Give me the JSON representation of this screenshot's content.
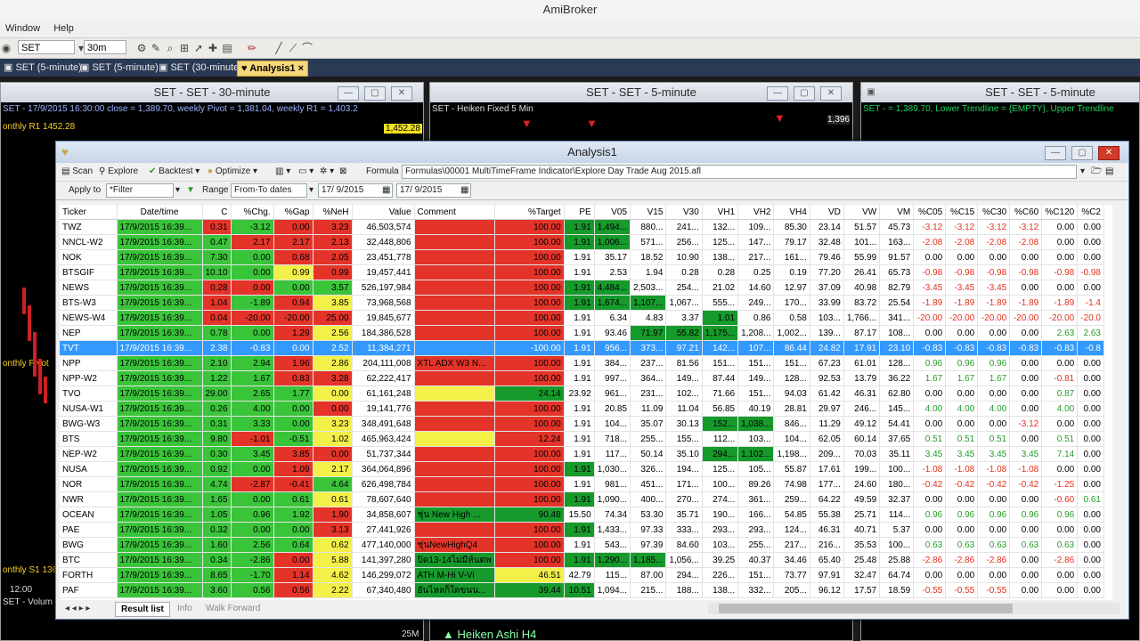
{
  "app": {
    "title": "AmiBroker",
    "menu": [
      "Window",
      "Help"
    ]
  },
  "toolbar": {
    "symbol": "SET",
    "interval": "30m"
  },
  "doc_tabs": [
    "SET (5-minute)",
    "SET (5-minute)",
    "SET (30-minute)",
    "Analysis1"
  ],
  "chart1": {
    "title": "SET - SET - 30-minute",
    "info": "SET - 17/9/2015 16:30:00 close = 1,389.70, weekly Pivot = 1,381.04, weekly R1 = 1,403.2",
    "label1": "onthly R1 1452.28",
    "label2": "onthly Pivot",
    "label3": "onthly S1 136",
    "price_tag": "1,452.28",
    "time_tag": "12:00",
    "bottom": "SET - Volum"
  },
  "chart2": {
    "title": "SET - SET - 5-minute",
    "info": "SET - Heiken Fixed 5 Min",
    "bottom": "Heiken Ashi H4",
    "vol": "25M"
  },
  "chart3": {
    "title": "SET - SET - 5-minute",
    "info": "SET - = 1,389.70, Lower Trendline = {EMPTY}, Upper Trendline",
    "price_tag": "1,396"
  },
  "analysis": {
    "title": "Analysis1",
    "scan": "Scan",
    "explore": "Explore",
    "backtest": "Backtest",
    "optimize": "Optimize",
    "formula_label": "Formula",
    "formula": "Formulas\\00001 MultiTimeFrame Indicator\\Explore Day Trade Aug 2015.afl",
    "apply_label": "Apply to",
    "apply_value": "*Filter",
    "range_label": "Range",
    "range_value": "From-To dates",
    "from_date": "17/ 9/2015",
    "to_date": "17/ 9/2015",
    "bottom_tabs": [
      "Result list",
      "Info",
      "Walk Forward"
    ]
  },
  "columns": [
    "Ticker",
    "Date/time",
    "C",
    "%Chg.",
    "%Gap",
    "%NeH",
    "Value",
    "Comment",
    "%Target",
    "PE",
    "V05",
    "V15",
    "V30",
    "VH1",
    "VH2",
    "VH4",
    "VD",
    "VW",
    "VM",
    "%C05",
    "%C15",
    "%C30",
    "%C60",
    "%C120",
    "%C2"
  ],
  "rows": [
    [
      "TWZ",
      "17/9/2015 16:39...",
      "0.31",
      "-3.12",
      "0.00",
      "3.23",
      "46,503,574",
      "",
      "100.00",
      "1.91",
      "1,494...",
      "880...",
      "241...",
      "132...",
      "109...",
      "85.30",
      "23.14",
      "51.57",
      "45.73",
      "-3.12",
      "-3.12",
      "-3.12",
      "-3.12",
      "0.00",
      "0.00"
    ],
    [
      "NNCL-W2",
      "17/9/2015 16:39...",
      "0.47",
      "2.17",
      "2.17",
      "2.13",
      "32,448,806",
      "",
      "100.00",
      "1.91",
      "1,006...",
      "571...",
      "256...",
      "125...",
      "147...",
      "79.17",
      "32.48",
      "101...",
      "163...",
      "-2.08",
      "-2.08",
      "-2.08",
      "-2.08",
      "0.00",
      "0.00"
    ],
    [
      "NOK",
      "17/9/2015 16:39...",
      "7.30",
      "0.00",
      "0.68",
      "2.05",
      "23,451,778",
      "",
      "100.00",
      "1.91",
      "35.17",
      "18.52",
      "10.90",
      "138...",
      "217...",
      "161...",
      "79.46",
      "55.99",
      "91.57",
      "0.00",
      "0.00",
      "0.00",
      "0.00",
      "0.00",
      "0.00"
    ],
    [
      "BTSGIF",
      "17/9/2015 16:39...",
      "10.10",
      "0.00",
      "0.99",
      "0.99",
      "19,457,441",
      "",
      "100.00",
      "1.91",
      "2.53",
      "1.94",
      "0.28",
      "0.28",
      "0.25",
      "0.19",
      "77.20",
      "26.41",
      "65.73",
      "-0.98",
      "-0.98",
      "-0.98",
      "-0.98",
      "-0.98",
      "-0.98"
    ],
    [
      "NEWS",
      "17/9/2015 16:39...",
      "0.28",
      "0.00",
      "0.00",
      "3.57",
      "526,197,984",
      "",
      "100.00",
      "1.91",
      "4,484...",
      "2,503...",
      "254...",
      "21.02",
      "14.60",
      "12.97",
      "37.09",
      "40.98",
      "82.79",
      "-3.45",
      "-3.45",
      "-3.45",
      "0.00",
      "0.00",
      "0.00"
    ],
    [
      "BTS-W3",
      "17/9/2015 16:39...",
      "1.04",
      "-1.89",
      "0.94",
      "3.85",
      "73,968,568",
      "",
      "100.00",
      "1.91",
      "1,674...",
      "1,107...",
      "1,067...",
      "555...",
      "249...",
      "170...",
      "33.99",
      "83.72",
      "25.54",
      "-1.89",
      "-1.89",
      "-1.89",
      "-1.89",
      "-1.89",
      "-1.4"
    ],
    [
      "NEWS-W4",
      "17/9/2015 16:39...",
      "0.04",
      "-20.00",
      "-20.00",
      "25.00",
      "19,845,677",
      "",
      "100.00",
      "1.91",
      "6.34",
      "4.83",
      "3.37",
      "1.01",
      "0.86",
      "0.58",
      "103...",
      "1,766...",
      "341...",
      "-20.00",
      "-20.00",
      "-20.00",
      "-20.00",
      "-20.00",
      "-20.0"
    ],
    [
      "NEP",
      "17/9/2015 16:39...",
      "0.78",
      "0.00",
      "1.29",
      "2.56",
      "184,386,528",
      "",
      "100.00",
      "1.91",
      "93.46",
      "71.97",
      "55.82",
      "1,175...",
      "1,208...",
      "1,002...",
      "139...",
      "87.17",
      "108...",
      "0.00",
      "0.00",
      "0.00",
      "0.00",
      "2.63",
      "2.63"
    ],
    [
      "TVT",
      "17/9/2015 16:39...",
      "2.38",
      "-0.83",
      "0.00",
      "2.52",
      "11,384,271",
      "",
      "-100.00",
      "1.91",
      "956...",
      "373...",
      "97.21",
      "142...",
      "107...",
      "86.44",
      "24.82",
      "17.91",
      "23.10",
      "-0.83",
      "-0.83",
      "-0.83",
      "-0.83",
      "-0.83",
      "-0.8"
    ],
    [
      "NPP",
      "17/9/2015 16:39...",
      "2.10",
      "2.94",
      "1.96",
      "2.86",
      "204,111,008",
      "XTL ADX W3 N...",
      "100.00",
      "1.91",
      "384...",
      "237...",
      "81.56",
      "151...",
      "151...",
      "151...",
      "67.23",
      "61.01",
      "128...",
      "0.96",
      "0.96",
      "0.96",
      "0.00",
      "0.00",
      "0.00"
    ],
    [
      "NPP-W2",
      "17/9/2015 16:39...",
      "1.22",
      "1.67",
      "0.83",
      "3.28",
      "62,222,417",
      "",
      "100.00",
      "1.91",
      "997...",
      "364...",
      "149...",
      "87.44",
      "149...",
      "128...",
      "92.53",
      "13.79",
      "36.22",
      "1.67",
      "1.67",
      "1.67",
      "0.00",
      "-0.81",
      "0.00"
    ],
    [
      "TVO",
      "17/9/2015 16:39...",
      "29.00",
      "2.65",
      "1.77",
      "0.00",
      "61,161,248",
      "",
      "24.14",
      "23.92",
      "961...",
      "231...",
      "102...",
      "71.66",
      "151...",
      "94.03",
      "61.42",
      "46.31",
      "62.80",
      "0.00",
      "0.00",
      "0.00",
      "0.00",
      "0.87",
      "0.00"
    ],
    [
      "NUSA-W1",
      "17/9/2015 16:39...",
      "0.26",
      "4.00",
      "0.00",
      "0.00",
      "19,141,776",
      "",
      "100.00",
      "1.91",
      "20.85",
      "11.09",
      "11.04",
      "56.85",
      "40.19",
      "28.81",
      "29.97",
      "246...",
      "145...",
      "4.00",
      "4.00",
      "4.00",
      "0.00",
      "4.00",
      "0.00"
    ],
    [
      "BWG-W3",
      "17/9/2015 16:39...",
      "0.31",
      "3.33",
      "0.00",
      "3.23",
      "348,491,648",
      "",
      "100.00",
      "1.91",
      "104...",
      "35.07",
      "30.13",
      "152...",
      "1,038...",
      "846...",
      "11.29",
      "49.12",
      "54.41",
      "0.00",
      "0.00",
      "0.00",
      "-3.12",
      "0.00",
      "0.00"
    ],
    [
      "BTS",
      "17/9/2015 16:39...",
      "9.80",
      "-1.01",
      "-0.51",
      "1.02",
      "465,963,424",
      "",
      "12.24",
      "1.91",
      "718...",
      "255...",
      "155...",
      "112...",
      "103...",
      "104...",
      "62.05",
      "60.14",
      "37.65",
      "0.51",
      "0.51",
      "0.51",
      "0.00",
      "0.51",
      "0.00"
    ],
    [
      "NEP-W2",
      "17/9/2015 16:39...",
      "0.30",
      "3.45",
      "3.85",
      "0.00",
      "51,737,344",
      "",
      "100.00",
      "1.91",
      "117...",
      "50.14",
      "35.10",
      "294...",
      "1,102...",
      "1,198...",
      "209...",
      "70.03",
      "35.11",
      "3.45",
      "3.45",
      "3.45",
      "3.45",
      "7.14",
      "0.00"
    ],
    [
      "NUSA",
      "17/9/2015 16:39...",
      "0.92",
      "0.00",
      "1.09",
      "2.17",
      "364,064,896",
      "",
      "100.00",
      "1.91",
      "1,030...",
      "326...",
      "194...",
      "125...",
      "105...",
      "55.87",
      "17.61",
      "199...",
      "100...",
      "-1.08",
      "-1.08",
      "-1.08",
      "-1.08",
      "0.00",
      "0.00"
    ],
    [
      "NOR",
      "17/9/2015 16:39...",
      "4.74",
      "-2.87",
      "-0.41",
      "4.64",
      "626,498,784",
      "",
      "100.00",
      "1.91",
      "981...",
      "451...",
      "171...",
      "100...",
      "89.26",
      "74.98",
      "177...",
      "24.60",
      "180...",
      "-0.42",
      "-0.42",
      "-0.42",
      "-0.42",
      "-1.25",
      "0.00"
    ],
    [
      "NWR",
      "17/9/2015 16:39...",
      "1.65",
      "0.00",
      "0.61",
      "0.61",
      "78,607,640",
      "",
      "100.00",
      "1.91",
      "1,090...",
      "400...",
      "270...",
      "274...",
      "361...",
      "259...",
      "64.22",
      "49.59",
      "32.37",
      "0.00",
      "0.00",
      "0.00",
      "0.00",
      "-0.60",
      "0.61"
    ],
    [
      "OCEAN",
      "17/9/2015 16:39...",
      "1.05",
      "0.96",
      "1.92",
      "1.90",
      "34,858,607",
      "ชุ่น New High ...",
      "90.48",
      "15.50",
      "74.34",
      "53.30",
      "35.71",
      "190...",
      "166...",
      "54.85",
      "55.38",
      "25.71",
      "114...",
      "0.96",
      "0.96",
      "0.96",
      "0.96",
      "0.96",
      "0.00"
    ],
    [
      "PAE",
      "17/9/2015 16:39...",
      "0.32",
      "0.00",
      "0.00",
      "3.13",
      "27,441,926",
      "",
      "100.00",
      "1.91",
      "1,433...",
      "97.33",
      "333...",
      "293...",
      "293...",
      "124...",
      "46.31",
      "40.71",
      "5.37",
      "0.00",
      "0.00",
      "0.00",
      "0.00",
      "0.00",
      "0.00"
    ],
    [
      "BWG",
      "17/9/2015 16:39...",
      "1.60",
      "2.56",
      "0.64",
      "0.62",
      "477,140,000",
      "ชุ่นNewHighQ4",
      "100.00",
      "1.91",
      "543...",
      "97.39",
      "84.60",
      "103...",
      "255...",
      "217...",
      "216...",
      "35.53",
      "100...",
      "0.63",
      "0.63",
      "0.63",
      "0.63",
      "0.63",
      "0.00"
    ],
    [
      "BTC",
      "17/9/2015 16:39...",
      "0.34",
      "-2.86",
      "0.00",
      "5.88",
      "141,397,280",
      "ปิด13-14ไม่มีห้นดพ",
      "100.00",
      "1.91",
      "1,290...",
      "1,185...",
      "1,056...",
      "39.25",
      "40.37",
      "34.46",
      "65.40",
      "25.48",
      "25.88",
      "-2.86",
      "-2.86",
      "-2.86",
      "0.00",
      "-2.86",
      "0.00"
    ],
    [
      "FORTH",
      "17/9/2015 16:39...",
      "8.65",
      "-1.70",
      "1.14",
      "4.62",
      "146,299,072",
      "ATH M-Hi V-Vi",
      "46.51",
      "42.79",
      "115...",
      "87.00",
      "294...",
      "226...",
      "151...",
      "73.77",
      "97.91",
      "32.47",
      "64.74",
      "0.00",
      "0.00",
      "0.00",
      "0.00",
      "0.00",
      "0.00"
    ],
    [
      "PAF",
      "17/9/2015 16:39...",
      "3.60",
      "0.56",
      "0.56",
      "2.22",
      "67,340,480",
      "อันไหลก็ใดขนน...",
      "39.44",
      "10.51",
      "1,094...",
      "215...",
      "188...",
      "138...",
      "332...",
      "205...",
      "96.12",
      "17.57",
      "18.59",
      "-0.55",
      "-0.55",
      "-0.55",
      "0.00",
      "0.00",
      "0.00"
    ]
  ],
  "cell_colors": [
    "g.r.g.r.r..r.r.dg.dg.....",
    "g.g.r.r.r..r.r.dg.dg.....",
    "g.g.g.r.r..r.r..........",
    "g.g.g.y.r..r.r..........",
    "g.r.r.g.g..r.r.dg.dg.....",
    "g.r.g.r.y..r.r.dg.dg.dg....",
    "g.r.r.r.r..r.r.....dg...",
    "g.g.g.r.y..r.r...dg.dg.dg..",
    "g.g.g.r.y..r.r..........",
    "g.g.g.r.y..r.r..........",
    "g.g.g.r.r..r.r..........",
    "g.g.g.g.y..y.dg..........",
    "g.g.g.g.r..r.r..........",
    "g.g.g.g.y..r.r.....dg.dg...",
    "g.g.r.g.y..y.r..........",
    "g.g.g.r.r..r.r.....dg.dg...",
    "g.g.g.r.y..r.r.dg.........",
    "g.g.r.r.g..r.r..........",
    "g.g.g.g.y..r.r.dg.........",
    "g.g.g.g.r..dg.dg..........",
    "g.g.g.g.r..r.r.dg.........",
    "g.g.g.g.y..r.r..........",
    "g.g.g.r.y..dg.r.dg.dg.dg....",
    "g.g.g.r.y..dg.y..........",
    "g.g.g.r.y..dg.dg.dg.........."
  ],
  "selected_row": 8
}
